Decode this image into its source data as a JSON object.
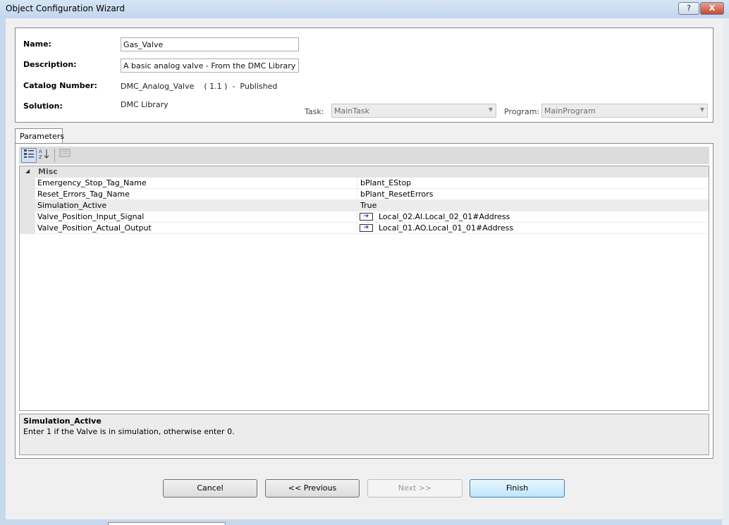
{
  "window": {
    "title": "Object Configuration Wizard",
    "help_label": "?",
    "close_label": "X"
  },
  "form": {
    "name_label": "Name:",
    "name_value": "Gas_Valve",
    "description_label": "Description:",
    "description_value": "A basic analog valve - From the DMC Library",
    "catalog_label": "Catalog Number:",
    "catalog_value": "DMC_Analog_Valve    ( 1.1 )  -  Published",
    "solution_label": "Solution:",
    "solution_value": "DMC Library",
    "task_label": "Task:",
    "task_value": "MainTask",
    "program_label": "Program:",
    "program_value": "MainProgram"
  },
  "tabs": [
    {
      "label": "Parameters"
    }
  ],
  "grid": {
    "category": "Misc",
    "rows": [
      {
        "name": "Emergency_Stop_Tag_Name",
        "value": "bPlant_EStop",
        "link": false
      },
      {
        "name": "Reset_Errors_Tag_Name",
        "value": "bPlant_ResetErrors",
        "link": false
      },
      {
        "name": "Simulation_Active",
        "value": "True",
        "link": false
      },
      {
        "name": "Valve_Position_Input_Signal",
        "value": "Local_02.AI.Local_02_01#Address",
        "link": true
      },
      {
        "name": "Valve_Position_Actual_Output",
        "value": "Local_01.AO.Local_01_01#Address",
        "link": true
      }
    ]
  },
  "description_panel": {
    "title": "Simulation_Active",
    "text": "Enter 1 if the Valve is in simulation, otherwise enter 0."
  },
  "buttons": {
    "cancel": "Cancel",
    "previous": "<< Previous",
    "next": "Next >>",
    "finish": "Finish"
  }
}
